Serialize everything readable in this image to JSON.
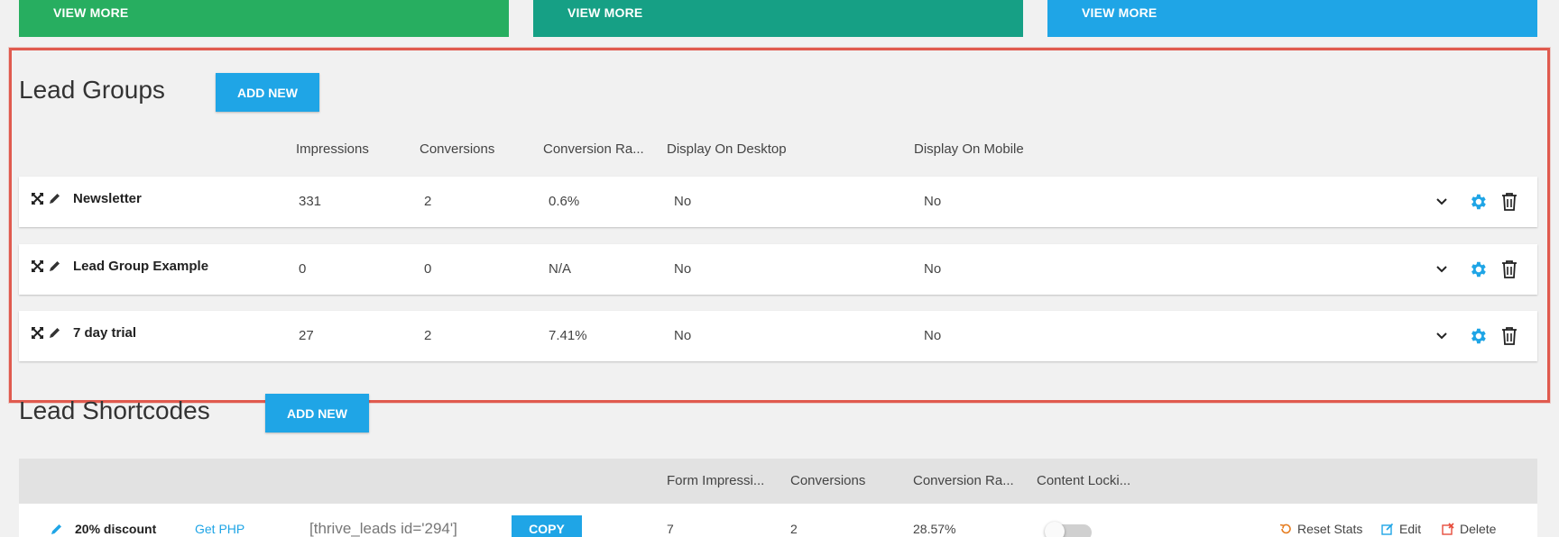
{
  "top_bars": {
    "green": {
      "label": "VIEW MORE",
      "color": "#27ae60"
    },
    "teal": {
      "label": "VIEW MORE",
      "color": "#16a085"
    },
    "blue": {
      "label": "VIEW MORE",
      "color": "#1fa5e6"
    }
  },
  "lead_groups": {
    "title": "Lead Groups",
    "add_label": "ADD NEW",
    "columns": [
      "Impressions",
      "Conversions",
      "Conversion Ra...",
      "Display On Desktop",
      "Display On Mobile"
    ],
    "rows": [
      {
        "name": "Newsletter",
        "impressions": "331",
        "conversions": "2",
        "rate": "0.6%",
        "desktop": "No",
        "mobile": "No"
      },
      {
        "name": "Lead Group Example",
        "impressions": "0",
        "conversions": "0",
        "rate": "N/A",
        "desktop": "No",
        "mobile": "No"
      },
      {
        "name": "7 day trial",
        "impressions": "27",
        "conversions": "2",
        "rate": "7.41%",
        "desktop": "No",
        "mobile": "No"
      }
    ]
  },
  "lead_shortcodes": {
    "title": "Lead Shortcodes",
    "add_label": "ADD NEW",
    "columns": [
      "Form Impressi...",
      "Conversions",
      "Conversion Ra...",
      "Content Locki..."
    ],
    "row": {
      "name": "20% discount",
      "php_link": "Get PHP",
      "shortcode": "[thrive_leads id='294']",
      "copy_label": "COPY",
      "impressions": "7",
      "conversions": "2",
      "rate": "28.57%",
      "content_locking": false,
      "reset_label": "Reset Stats",
      "edit_label": "Edit",
      "delete_label": "Delete"
    }
  },
  "colors": {
    "accent": "#1fa5e6",
    "highlight": "#e05a4e",
    "reset": "#e67e22",
    "delete": "#e74c3c"
  }
}
